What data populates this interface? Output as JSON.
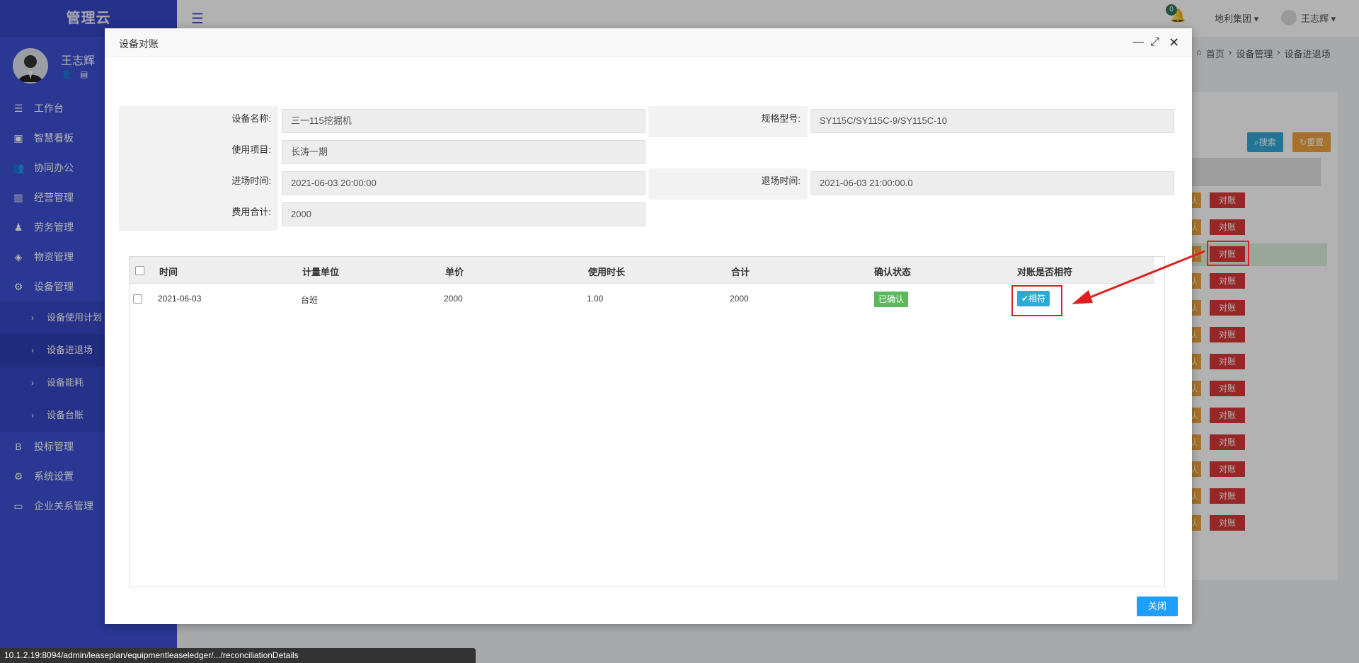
{
  "sidebar": {
    "brand": "管理云",
    "user_name": "王志辉",
    "items": [
      {
        "icon": "workbench-icon",
        "glyph": "☰",
        "label": "工作台"
      },
      {
        "icon": "dashboard-icon",
        "glyph": "▣",
        "label": "智慧看板"
      },
      {
        "icon": "users-icon",
        "glyph": "👥",
        "label": "协同办公"
      },
      {
        "icon": "bar-chart-icon",
        "glyph": "▥",
        "label": "经营管理"
      },
      {
        "icon": "worker-icon",
        "glyph": "♟",
        "label": "劳务管理"
      },
      {
        "icon": "cube-icon",
        "glyph": "◈",
        "label": "物资管理"
      },
      {
        "icon": "cogs-icon",
        "glyph": "⚙",
        "label": "设备管理"
      }
    ],
    "sub_items": [
      "设备使用计划",
      "设备进退场",
      "设备能耗",
      "设备台账"
    ],
    "items_after": [
      {
        "icon": "bold-b-icon",
        "glyph": "B",
        "label": "投标管理"
      },
      {
        "icon": "gear-icon",
        "glyph": "⚙",
        "label": "系统设置"
      },
      {
        "icon": "monitor-icon",
        "glyph": "▭",
        "label": "企业关系管理"
      }
    ]
  },
  "topbar": {
    "notification_count": "0",
    "group": "地利集团 ▾",
    "user": "王志辉 ▾"
  },
  "breadcrumb": [
    "首页",
    "设备管理",
    "设备进退场"
  ],
  "background": {
    "search_label": "搜索",
    "reset_label": "重置",
    "row_confirm": "认",
    "row_reconcile": "对账",
    "row_count": 13
  },
  "modal": {
    "title": "设备对账",
    "fields": {
      "device_name_label": "设备名称:",
      "device_name_value": "三一115挖掘机",
      "spec_label": "规格型号:",
      "spec_value": "SY115C/SY115C-9/SY115C-10",
      "project_label": "使用项目:",
      "project_value": "长涛一期",
      "entry_label": "进场时间:",
      "entry_value": "2021-06-03 20:00:00",
      "exit_label": "退场时间:",
      "exit_value": "2021-06-03 21:00:00.0",
      "total_label": "费用合计:",
      "total_value": "2000"
    },
    "table": {
      "headers": [
        "时间",
        "计量单位",
        "单价",
        "使用时长",
        "合计",
        "确认状态",
        "对账是否相符"
      ],
      "rows": [
        {
          "time": "2021-06-03",
          "unit": "台班",
          "price": "2000",
          "duration": "1.00",
          "total": "2000",
          "status": "已确认",
          "match": "✔相符"
        }
      ]
    },
    "close_label": "关闭"
  },
  "status_bar": "10.1.2.19:8094/admin/leaseplan/equipmentleaseledger/.../reconciliationDetails",
  "colors": {
    "sidebar": "#3d4fd3",
    "primary": "#1e9fff",
    "confirm_green": "#5cb85c",
    "match_blue": "#2ea9d5",
    "reconcile_red": "#d93838",
    "highlight_red": "#e02020"
  }
}
